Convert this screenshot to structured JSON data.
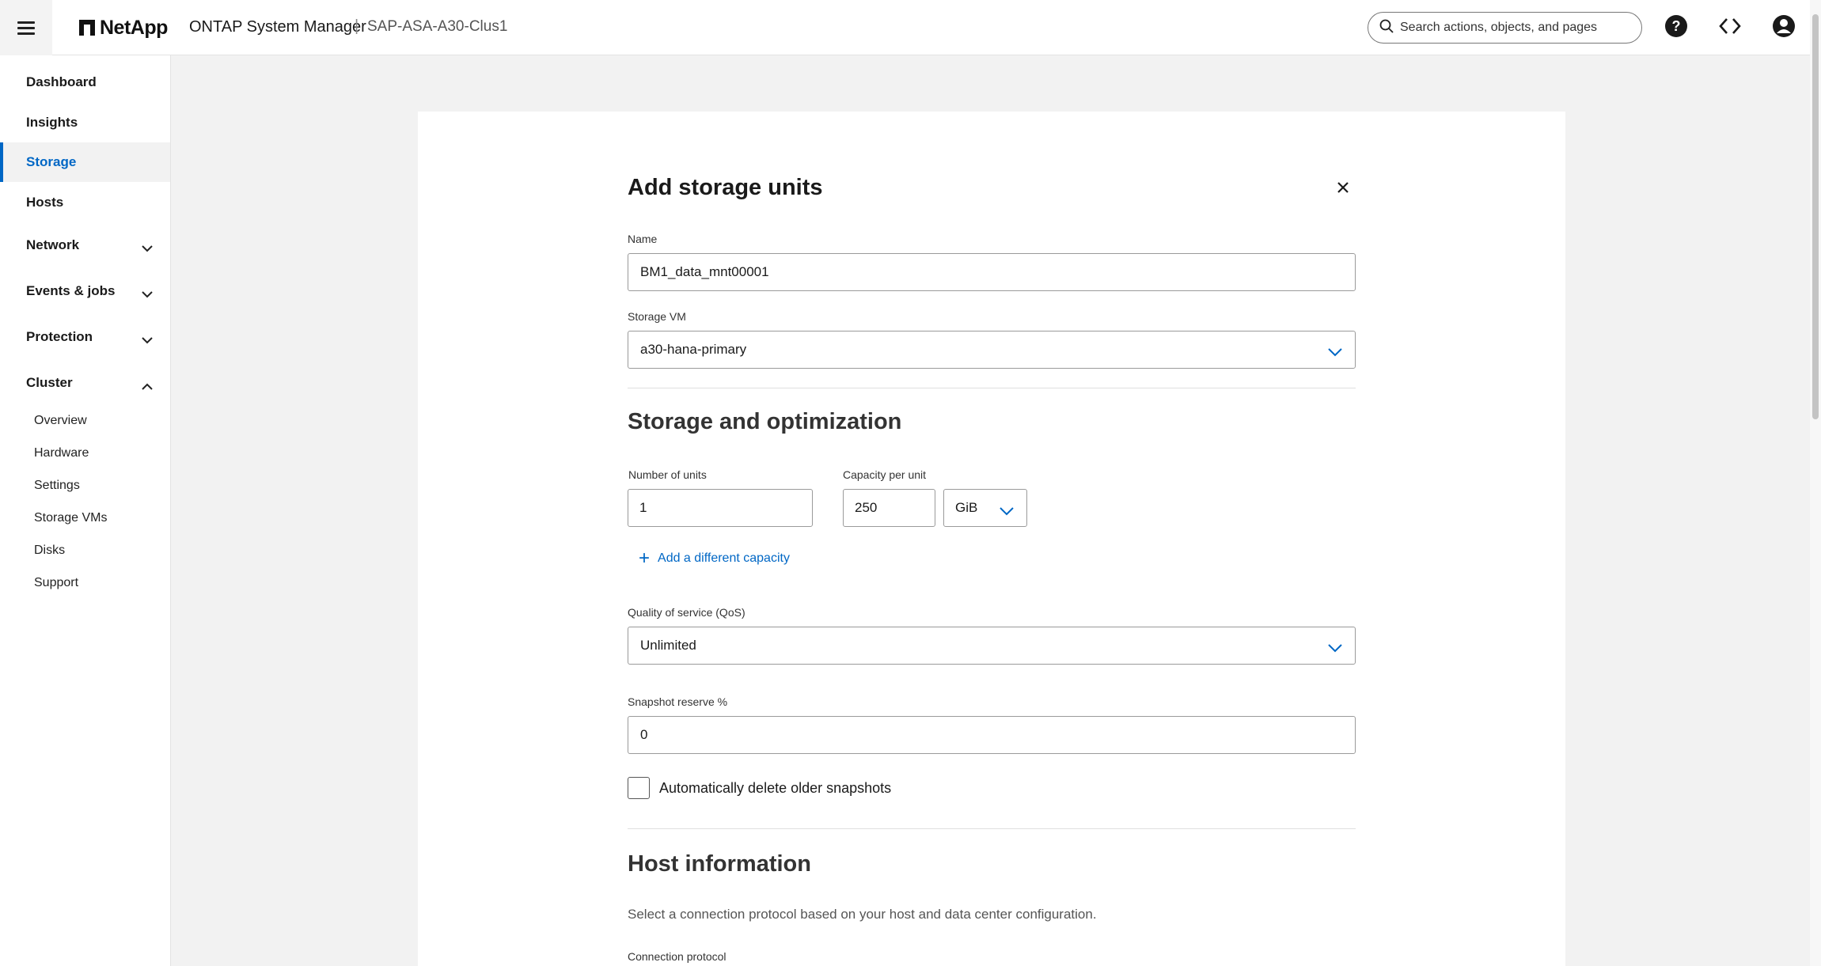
{
  "header": {
    "menu_icon": "hamburger-icon",
    "brand": "NetApp",
    "product": "ONTAP System Manager",
    "separator": "|",
    "cluster": "SAP-ASA-A30-Clus1",
    "search_placeholder": "Search actions, objects, and pages",
    "icons": [
      "help-icon",
      "code-icon",
      "user-icon"
    ]
  },
  "sidebar": {
    "items": [
      {
        "label": "Dashboard"
      },
      {
        "label": "Insights"
      },
      {
        "label": "Storage"
      },
      {
        "label": "Hosts"
      },
      {
        "label": "Network"
      },
      {
        "label": "Events & jobs"
      },
      {
        "label": "Protection"
      },
      {
        "label": "Cluster"
      }
    ],
    "cluster_sub": [
      {
        "label": "Overview"
      },
      {
        "label": "Hardware"
      },
      {
        "label": "Settings"
      },
      {
        "label": "Storage VMs"
      },
      {
        "label": "Disks"
      },
      {
        "label": "Support"
      }
    ]
  },
  "dialog": {
    "title": "Add storage units",
    "name_label": "Name",
    "name_value": "BM1_data_mnt00001",
    "svm_label": "Storage VM",
    "svm_value": "a30-hana-primary",
    "section_storage": "Storage and optimization",
    "units_label": "Number of units",
    "units_value": "1",
    "capacity_label": "Capacity per unit",
    "capacity_value": "250",
    "capacity_unit": "GiB",
    "add_capacity": "Add a different capacity",
    "qos_label": "Quality of service (QoS)",
    "qos_value": "Unlimited",
    "snapshot_label": "Snapshot reserve %",
    "snapshot_value": "0",
    "auto_delete_label": "Automatically delete older snapshots",
    "section_host": "Host information",
    "host_help": "Select a connection protocol based on your host and data center configuration.",
    "protocol_label": "Connection protocol"
  },
  "colors": {
    "accent": "#0067c5",
    "background": "#f2f2f2"
  }
}
